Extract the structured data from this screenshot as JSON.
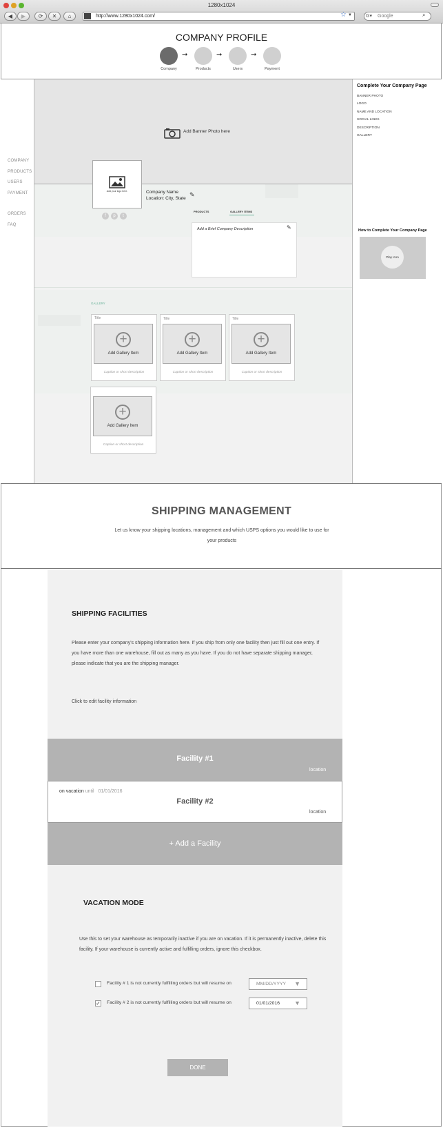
{
  "browser": {
    "window_title": "1280x1024",
    "url": "http://www.1280x1024.com/",
    "search_placeholder": "Google"
  },
  "header": {
    "title": "COMPANY PROFILE",
    "steps": [
      "Company",
      "Products",
      "Users",
      "Payment"
    ]
  },
  "left_nav": {
    "items": [
      "COMPANY",
      "PRODUCTS",
      "USERS",
      "PAYMENT"
    ],
    "items2": [
      "ORDERS",
      "FAQ"
    ]
  },
  "profile": {
    "banner_label": "Add Banner Photo here",
    "logo_label": "Add your logo here.",
    "company_name": "Company Name",
    "location": "Location: City, State",
    "tabs": [
      "PRODUCTS",
      "GALLERY ITEMS"
    ],
    "description_placeholder": "Add a Brief Company Description",
    "gallery_label": "GALLERY",
    "gallery_items": [
      {
        "title": "Title",
        "add": "Add Gallery Item",
        "caption": "Caption or short description"
      },
      {
        "title": "Title",
        "add": "Add Gallery Item",
        "caption": "Caption or short description"
      },
      {
        "title": "Title",
        "add": "Add Gallery Item",
        "caption": "Caption or short description"
      },
      {
        "title": "",
        "add": "Add Gallery Item",
        "caption": "Caption or short description"
      }
    ]
  },
  "right_panel": {
    "title": "Complete Your Company Page",
    "items": [
      "BANNER PHOTO",
      "LOGO",
      "NAME AND LOCATION",
      "SOCIAL LINKS",
      "DESCRIPTION",
      "GALLERY"
    ],
    "how_title": "How to Complete Your Company Page",
    "play_label": "Play Icon"
  },
  "shipping": {
    "title": "SHIPPING MANAGEMENT",
    "intro": "Let us know your shipping locations, management and which USPS options you would like to use for your products",
    "facilities_heading": "SHIPPING FACILITIES",
    "facilities_desc": "Please enter your company's shipping information here. If you ship from only one facility then just fill out one entry. If you have more than one warehouse, fill out as many as you have. If you do not have separate shipping manager, please indicate that you are the shipping manager.",
    "edit_hint": "Click to edit facility information",
    "facility1": {
      "name": "Facility #1",
      "location": "location"
    },
    "facility2": {
      "name": "Facility #2",
      "location": "location",
      "vacation_prefix": "on vacation",
      "vacation_until": "until",
      "vacation_date": "01/01/2016"
    },
    "add_facility": "+ Add a Facility",
    "vacation_heading": "VACATION MODE",
    "vacation_desc": "Use this to set your warehouse as temporarily inactive if you are on vacation. If it is permanently inactive, delete this facility. If your warehouse is currently active and fulfilling orders, ignore this checkbox.",
    "vacation_rows": [
      {
        "label": "Facility # 1 is not currently fulfilling orders but will resume on",
        "date": "MM/DD/YYYY",
        "checked": false
      },
      {
        "label": "Facility # 2 is not currently fulfilling orders but will resume on",
        "date": "01/01/2016",
        "checked": true
      }
    ],
    "done_label": "DONE"
  }
}
